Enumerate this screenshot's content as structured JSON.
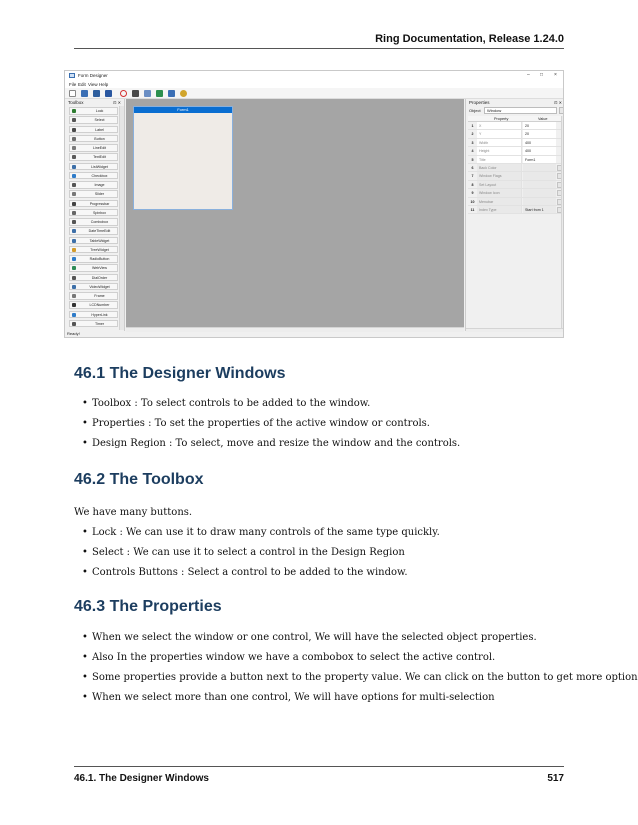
{
  "header": {
    "running_title": "Ring Documentation, Release 1.24.0"
  },
  "screenshot": {
    "window_title": "Form Designer",
    "window_controls": {
      "minimize": "–",
      "maximize": "□",
      "close": "×"
    },
    "menu": [
      "File",
      "Edit",
      "View",
      "Help"
    ],
    "toolbar_icons": [
      "new-file-icon",
      "open-folder-icon",
      "save-icon",
      "save-as-icon",
      "stop-icon",
      "run-icon",
      "form-icon",
      "tree-icon",
      "dock-icon",
      "palette-icon"
    ],
    "toolbox": {
      "title": "Toolbox",
      "controls": "⊡ ✕",
      "items": [
        {
          "label": "Lock",
          "icon": "lock-icon",
          "color": "#2e7d32"
        },
        {
          "label": "Select",
          "icon": "cursor-icon",
          "color": "#555555"
        },
        {
          "label": "Label",
          "icon": "label-icon",
          "color": "#4a4a4a"
        },
        {
          "label": "Button",
          "icon": "button-icon",
          "color": "#6d6d6d"
        },
        {
          "label": "LineEdit",
          "icon": "lineedit-icon",
          "color": "#7a7a7a"
        },
        {
          "label": "TextEdit",
          "icon": "textedit-icon",
          "color": "#5a5a5a"
        },
        {
          "label": "ListWidget",
          "icon": "list-icon",
          "color": "#3d6fa8"
        },
        {
          "label": "Checkbox",
          "icon": "checkbox-icon",
          "color": "#2f7cc9"
        },
        {
          "label": "Image",
          "icon": "image-icon",
          "color": "#555555"
        },
        {
          "label": "Slider",
          "icon": "slider-icon",
          "color": "#777777"
        },
        {
          "label": "Progressbar",
          "icon": "progressbar-icon",
          "color": "#444444"
        },
        {
          "label": "Spinbox",
          "icon": "spinbox-icon",
          "color": "#666666"
        },
        {
          "label": "Combobox",
          "icon": "combobox-icon",
          "color": "#555555"
        },
        {
          "label": "DateTimeEdit",
          "icon": "datetime-icon",
          "color": "#3d6fa8"
        },
        {
          "label": "TableWidget",
          "icon": "table-icon",
          "color": "#3d6fa8"
        },
        {
          "label": "TreeWidget",
          "icon": "tree-icon",
          "color": "#d49b2a"
        },
        {
          "label": "RadioButton",
          "icon": "radio-icon",
          "color": "#2f7cc9"
        },
        {
          "label": "WebView",
          "icon": "webview-icon",
          "color": "#2e8b57"
        },
        {
          "label": "DialOrder",
          "icon": "dial-icon",
          "color": "#555555"
        },
        {
          "label": "VideoWidget",
          "icon": "video-icon",
          "color": "#3d6fa8"
        },
        {
          "label": "Frame",
          "icon": "frame-icon",
          "color": "#777777"
        },
        {
          "label": "LCDNumber",
          "icon": "lcd-icon",
          "color": "#333333"
        },
        {
          "label": "HyperLink",
          "icon": "hyperlink-icon",
          "color": "#2f7cc9"
        },
        {
          "label": "Timer",
          "icon": "timer-icon",
          "color": "#555555"
        }
      ]
    },
    "form_title": "Form1",
    "properties": {
      "title": "Properties",
      "controls": "⊡ ✕",
      "object_label": "Object",
      "object_value": "Window",
      "col_property": "Property",
      "col_value": "Value",
      "rows": [
        {
          "n": "1",
          "key": "X",
          "value": "20",
          "button": false
        },
        {
          "n": "2",
          "key": "Y",
          "value": "20",
          "button": false
        },
        {
          "n": "3",
          "key": "Width",
          "value": "400",
          "button": false
        },
        {
          "n": "4",
          "key": "Height",
          "value": "400",
          "button": false
        },
        {
          "n": "5",
          "key": "Title",
          "value": "Form1",
          "button": false
        },
        {
          "n": "6",
          "key": "Back Color",
          "value": "",
          "button": true
        },
        {
          "n": "7",
          "key": "Window Flags",
          "value": "",
          "button": true
        },
        {
          "n": "8",
          "key": "Set Layout",
          "value": "",
          "button": true
        },
        {
          "n": "9",
          "key": "Window Icon",
          "value": "",
          "button": true
        },
        {
          "n": "10",
          "key": "Menubar",
          "value": "",
          "button": true
        },
        {
          "n": "11",
          "key": "Index Type",
          "value": "Start from 1",
          "button": true
        }
      ]
    },
    "status": "Ready!"
  },
  "sections": [
    {
      "heading": "46.1 The Designer Windows",
      "bullets": [
        "Toolbox : To select controls to be added to the window.",
        "Properties : To set the properties of the active window or controls.",
        "Design Region : To select, move and resize the window and the controls."
      ]
    },
    {
      "heading": "46.2 The Toolbox",
      "intro": "We have many buttons.",
      "bullets": [
        "Lock : We can use it to draw many controls of the same type quickly.",
        "Select : We can use it to select a control in the Design Region",
        "Controls Buttons : Select a control to be added to the window."
      ]
    },
    {
      "heading": "46.3 The Properties",
      "bullets": [
        "When we select the window or one control, We will have the selected object properties.",
        "Also In the properties window we have a combobox to select the active control.",
        "Some properties provide a button next to the property value. We can click on the button to get more options.",
        "When we select more than one control, We will have options for multi-selection"
      ]
    }
  ],
  "footer": {
    "section": "46.1. The Designer Windows",
    "page": "517"
  }
}
